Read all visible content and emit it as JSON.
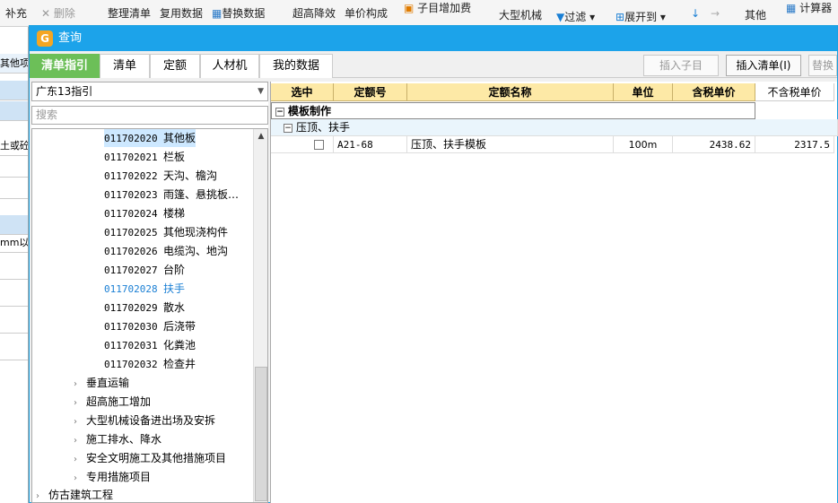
{
  "toolbar": {
    "items": [
      "补充",
      "删除",
      "整理清单",
      "复用数据",
      "替换数据",
      "超高降效",
      "单价构成",
      "子目增加费",
      "大型机械",
      "过滤",
      "展开到",
      "其他",
      "计算器"
    ]
  },
  "left_strip": {
    "rows": [
      "其他项",
      "",
      "土或砼",
      "",
      "",
      "mm以内"
    ]
  },
  "dialog": {
    "title": "查询",
    "tabs": [
      "清单指引",
      "清单",
      "定额",
      "人材机",
      "我的数据"
    ],
    "buttons": {
      "insert_sub": "插入子目",
      "insert_list": "插入清单(I)",
      "replace": "替换清"
    }
  },
  "left_panel": {
    "combo_value": "广东13指引",
    "search_placeholder": "搜索",
    "items": [
      {
        "code": "011702020",
        "name": "其他板"
      },
      {
        "code": "011702021",
        "name": "栏板"
      },
      {
        "code": "011702022",
        "name": "天沟、檐沟"
      },
      {
        "code": "011702023",
        "name": "雨篷、悬挑板…"
      },
      {
        "code": "011702024",
        "name": "楼梯"
      },
      {
        "code": "011702025",
        "name": "其他现浇构件"
      },
      {
        "code": "011702026",
        "name": "电缆沟、地沟"
      },
      {
        "code": "011702027",
        "name": "台阶"
      },
      {
        "code": "011702028",
        "name": "扶手"
      },
      {
        "code": "011702029",
        "name": "散水"
      },
      {
        "code": "011702030",
        "name": "后浇带"
      },
      {
        "code": "011702031",
        "name": "化粪池"
      },
      {
        "code": "011702032",
        "name": "检查井"
      }
    ],
    "groups": [
      "垂直运输",
      "超高施工增加",
      "大型机械设备进出场及安拆",
      "施工排水、降水",
      "安全文明施工及其他措施项目",
      "专用措施项目"
    ],
    "root": "仿古建筑工程"
  },
  "grid": {
    "headers": [
      "选中",
      "定额号",
      "定额名称",
      "单位",
      "含税单价",
      "不含税单价"
    ],
    "group1": "模板制作",
    "group2": "压顶、扶手",
    "row": {
      "code": "A21-68",
      "name": "压顶、扶手模板",
      "unit": "100m",
      "price_tax": "2438.62",
      "price_notax": "2317.5"
    }
  }
}
